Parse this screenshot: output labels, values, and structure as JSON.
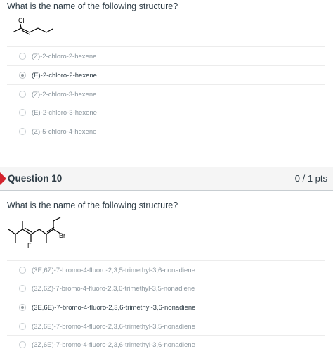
{
  "question9": {
    "prompt": "What is the name of the following structure?",
    "structure_labels": {
      "substituent": "Cl"
    },
    "options": [
      {
        "label": "(Z)-2-chloro-2-hexene",
        "selected": false
      },
      {
        "label": "(E)-2-chloro-2-hexene",
        "selected": true
      },
      {
        "label": "(Z)-2-chloro-3-hexene",
        "selected": false
      },
      {
        "label": "(E)-2-chloro-3-hexene",
        "selected": false
      },
      {
        "label": "(Z)-5-chloro-4-hexene",
        "selected": false
      }
    ]
  },
  "question10": {
    "title": "Question 10",
    "points": "0 / 1 pts",
    "flag_color": "#d4232d",
    "prompt": "What is the name of the following structure?",
    "structure_labels": {
      "substituent_1": "F",
      "substituent_2": "Br"
    },
    "options": [
      {
        "label": "(3E,6Z)-7-bromo-4-fluoro-2,3,5-trimethyl-3,6-nonadiene",
        "selected": false
      },
      {
        "label": "(3Z,6Z)-7-bromo-4-fluoro-2,3,6-trimethyl-3,5-nonadiene",
        "selected": false
      },
      {
        "label": "(3E,6E)-7-bromo-4-fluoro-2,3,6-trimethyl-3,6-nonadiene",
        "selected": true
      },
      {
        "label": "(3Z,6E)-7-bromo-4-fluoro-2,3,6-trimethyl-3,5-nonadiene",
        "selected": false
      },
      {
        "label": "(3Z,6E)-7-bromo-4-fluoro-2,3,6-trimethyl-3,6-nonadiene",
        "selected": false
      }
    ]
  }
}
